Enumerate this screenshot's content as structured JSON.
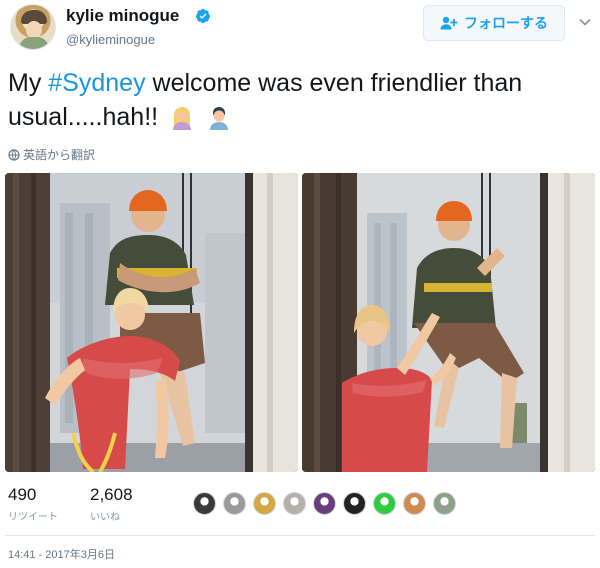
{
  "author": {
    "name": "kylie minogue",
    "handle": "@kylieminogue",
    "verified": true
  },
  "follow_button": {
    "label": "フォローする"
  },
  "tweet": {
    "prefix": "My ",
    "hashtag": "#Sydney",
    "suffix": " welcome was even friendlier than usual.....hah!!",
    "emojis": [
      "woman-emoji",
      "man-emoji"
    ]
  },
  "translate_link": "英語から翻訳",
  "stats": {
    "retweets": {
      "count": "490",
      "label": "リツイート"
    },
    "likes": {
      "count": "2,608",
      "label": "いいね"
    }
  },
  "likers": [
    {
      "name": "liker-avatar-1",
      "color": "#3a3a3a"
    },
    {
      "name": "liker-avatar-2",
      "color": "#9a9a9a"
    },
    {
      "name": "liker-avatar-3",
      "color": "#d6a640"
    },
    {
      "name": "liker-avatar-4",
      "color": "#b7b0a8"
    },
    {
      "name": "liker-avatar-5",
      "color": "#6a3d7a"
    },
    {
      "name": "liker-avatar-6",
      "color": "#222222"
    },
    {
      "name": "liker-avatar-7",
      "color": "#2ecc40"
    },
    {
      "name": "liker-avatar-8",
      "color": "#d08a50"
    },
    {
      "name": "liker-avatar-9",
      "color": "#8fa08a"
    }
  ],
  "timestamp": "14:41 - 2017年3月6日",
  "colors": {
    "link": "#1b95e0",
    "text": "#14171a",
    "muted": "#657786",
    "border": "#e1e8ed"
  }
}
